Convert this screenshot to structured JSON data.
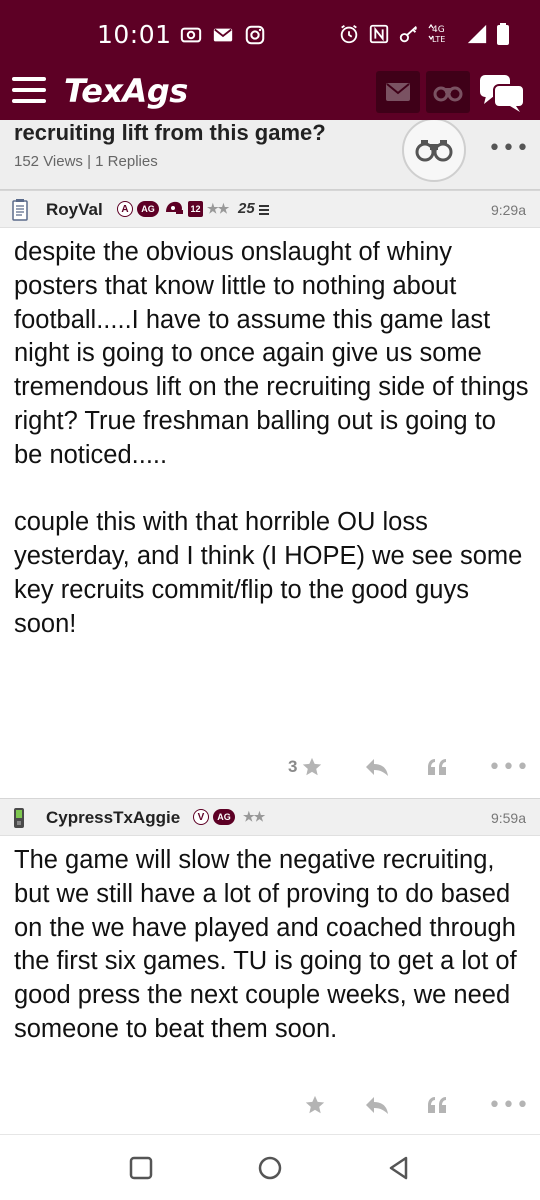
{
  "status_bar": {
    "time": "10:01",
    "network": "4G LTE"
  },
  "app": {
    "logo": "TexAgs"
  },
  "topic": {
    "title": "recruiting lift from this game?",
    "meta": "152 Views | 1 Replies"
  },
  "posts": [
    {
      "username": "RoyVal",
      "badges": {
        "a": "A",
        "ag": "AG",
        "num": "12",
        "stars": "★★",
        "year": "25"
      },
      "time": "9:29a",
      "body": [
        "despite the obvious onslaught of whiny posters that know little to nothing about football.....I have to assume this game last night is going to once again give us some tremendous lift on the recruiting side of things right? True freshman balling out is going to be noticed.....",
        "couple this with that horrible OU loss yesterday, and I think (I HOPE) we see some key recruits commit/flip to the good guys soon!"
      ],
      "star_count": "3"
    },
    {
      "username": "CypressTxAggie",
      "badges": {
        "v": "V",
        "ag": "AG",
        "stars": "★★"
      },
      "time": "9:59a",
      "body": [
        "The game will slow the negative recruiting, but we still have a lot of proving to do based on the we have played and coached through the first six games. TU is going to get a lot of good press the next couple weeks, we need someone to beat them soon."
      ],
      "star_count": ""
    }
  ],
  "icons": {
    "more": "•••",
    "star": "★"
  },
  "colors": {
    "brand": "#5d0025",
    "brand_dark": "#3f0018",
    "header_bg": "#f0f0f0",
    "icon_gray": "#b4b4b4"
  }
}
